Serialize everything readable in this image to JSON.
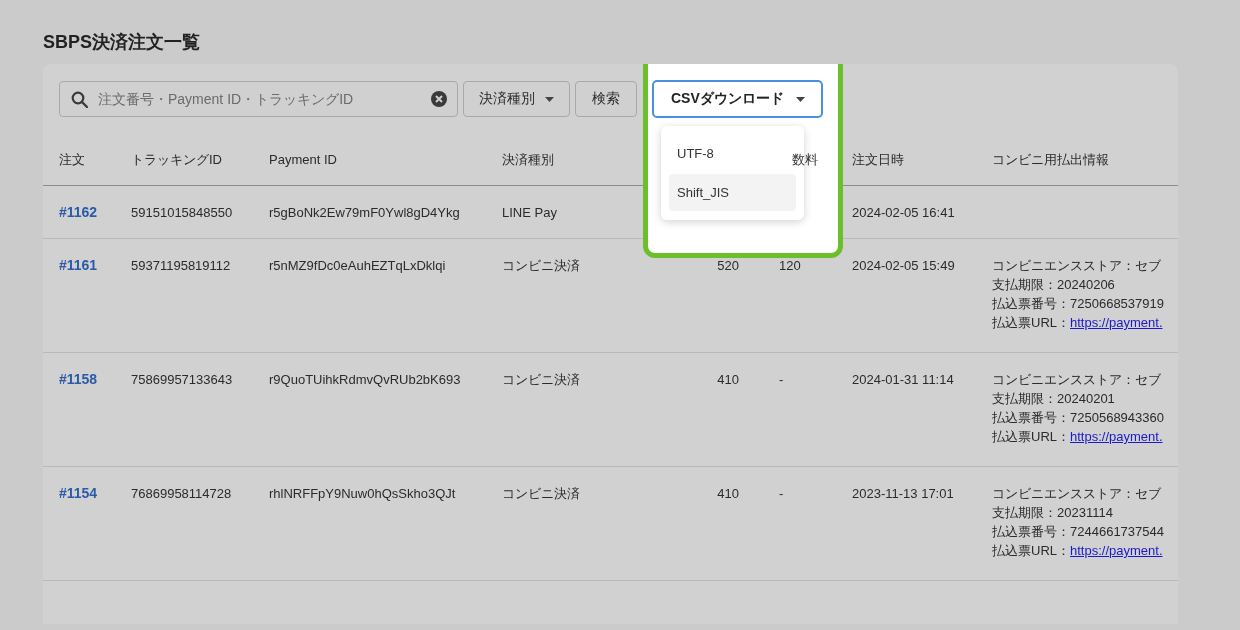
{
  "title": "SBPS決済注文一覧",
  "search": {
    "placeholder": "注文番号・Payment ID・トラッキングID"
  },
  "toolbar": {
    "method_filter": "決済種別",
    "search_button": "検索",
    "csv_button": {
      "label": "CSVダウンロード",
      "expanded": true
    }
  },
  "csv_menu": [
    {
      "label": "UTF-8",
      "selected": false
    },
    {
      "label": "Shift_JIS",
      "selected": true
    }
  ],
  "table": {
    "columns": [
      "注文",
      "トラッキングID",
      "Payment ID",
      "決済種別",
      "",
      "数料",
      "注文日時",
      "コンビニ用払出情報"
    ],
    "rows": [
      {
        "order": "#1162",
        "tracking_id": "59151015848550",
        "payment_id": "r5gBoNk2Ew79mF0Ywl8gD4Ykg",
        "method": "LINE Pay",
        "date": "2024-02-05 16:41"
      },
      {
        "order": "#1161",
        "tracking_id": "59371195819112",
        "payment_id": "r5nMZ9fDc0eAuhEZTqLxDklqi",
        "method": "コンビニ決済",
        "amount": "520",
        "fee": "120",
        "date": "2024-02-05 15:49",
        "info": {
          "store": "コンビニエンスストア：セブ",
          "deadline": "支払期限：20240206",
          "slip_number": "払込票番号：7250668537919",
          "url_label": "払込票URL：",
          "url": "https://payment."
        }
      },
      {
        "order": "#1158",
        "tracking_id": "75869957133643",
        "payment_id": "r9QuoTUihkRdmvQvRUb2bK693",
        "method": "コンビニ決済",
        "amount": "410",
        "fee": "-",
        "date": "2024-01-31 11:14",
        "info": {
          "store": "コンビニエンスストア：セブ",
          "deadline": "支払期限：20240201",
          "slip_number": "払込票番号：7250568943360",
          "url_label": "払込票URL：",
          "url": "https://payment."
        }
      },
      {
        "order": "#1154",
        "tracking_id": "76869958114728",
        "payment_id": "rhlNRFFpY9Nuw0hQsSkho3QJt",
        "method": "コンビニ決済",
        "amount": "410",
        "fee": "-",
        "date": "2023-11-13 17:01",
        "info": {
          "store": "コンビニエンスストア：セブ",
          "deadline": "支払期限：20231114",
          "slip_number": "払込票番号：7244661737544",
          "url_label": "払込票URL：",
          "url": "https://payment."
        }
      }
    ]
  }
}
